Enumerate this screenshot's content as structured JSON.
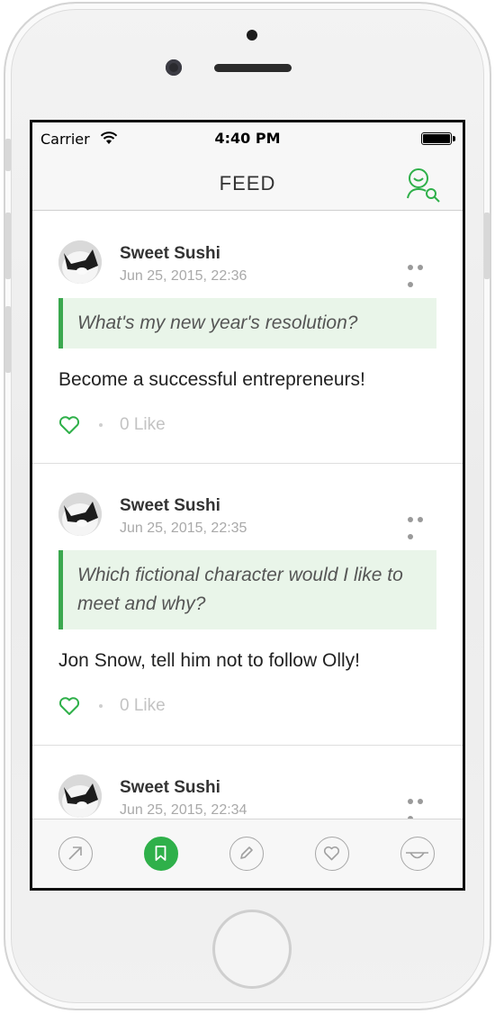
{
  "status_bar": {
    "carrier": "Carrier",
    "time": "4:40 PM"
  },
  "nav": {
    "title": "FEED"
  },
  "posts": [
    {
      "author": "Sweet Sushi",
      "timestamp": "Jun 25, 2015, 22:36",
      "question": "What's my new year's resolution?",
      "answer": "Become a successful entrepreneurs!",
      "likes": "0 Like"
    },
    {
      "author": "Sweet Sushi",
      "timestamp": "Jun 25, 2015, 22:35",
      "question": "Which fictional character would I like to meet and why?",
      "answer": "Jon Snow, tell him not to follow Olly!",
      "likes": "0 Like"
    },
    {
      "author": "Sweet Sushi",
      "timestamp": "Jun 25, 2015, 22:34"
    }
  ],
  "tabs": [
    {
      "icon": "arrow-up-right-icon"
    },
    {
      "icon": "bookmark-icon",
      "active": true
    },
    {
      "icon": "pencil-icon"
    },
    {
      "icon": "heart-icon"
    },
    {
      "icon": "smile-face-icon"
    }
  ],
  "colors": {
    "accent": "#2fb04a",
    "question_bg": "#e9f5e9",
    "question_border": "#3ba84f"
  }
}
